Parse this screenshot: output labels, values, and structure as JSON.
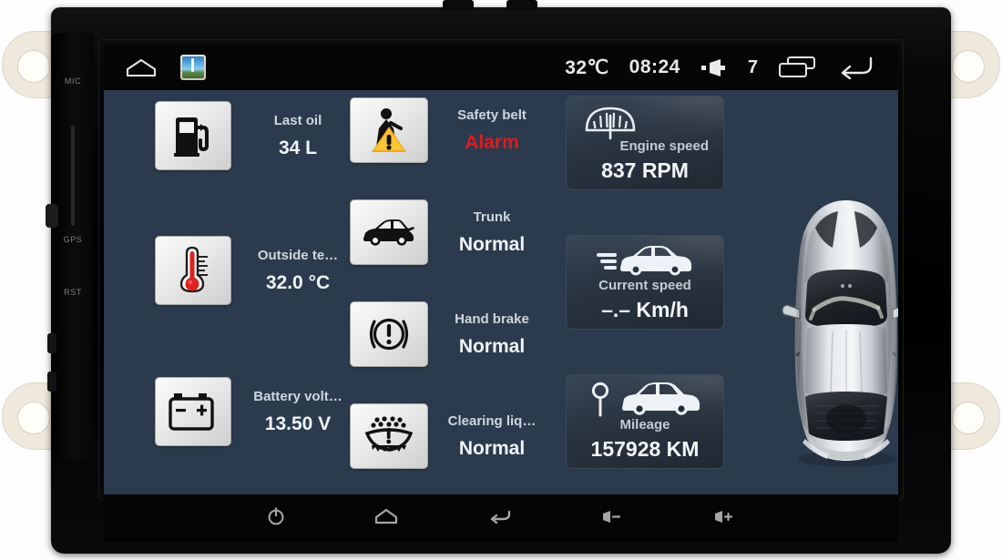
{
  "device": {
    "side_rail_labels": [
      "MIC",
      "GPS",
      "RST"
    ]
  },
  "statusbar": {
    "home_icon": "home-icon",
    "app_icon": "navigation-app-icon",
    "temperature": "32℃",
    "clock": "08:24",
    "volume_icon": "speaker-icon",
    "volume_level": "7",
    "recents_icon": "recent-apps-icon",
    "back_icon": "back-arrow-icon"
  },
  "left_column": [
    {
      "icon": "fuel-pump-icon",
      "label": "Last oil",
      "value": "34 L"
    },
    {
      "icon": "thermometer-icon",
      "label": "Outside te…",
      "value": "32.0 °C"
    },
    {
      "icon": "battery-icon",
      "label": "Battery volt…",
      "value": "13.50 V"
    }
  ],
  "middle_column": [
    {
      "icon": "seatbelt-warning-icon",
      "label": "Safety belt",
      "value": "Alarm",
      "state": "alarm"
    },
    {
      "icon": "car-trunk-icon",
      "label": "Trunk",
      "value": "Normal",
      "state": "normal"
    },
    {
      "icon": "hand-brake-icon",
      "label": "Hand brake",
      "value": "Normal",
      "state": "normal"
    },
    {
      "icon": "washer-fluid-icon",
      "label": "Clearing liq…",
      "value": "Normal",
      "state": "normal"
    }
  ],
  "right_panels": [
    {
      "icon": "tachometer-icon",
      "label": "Engine speed",
      "value": "837 RPM"
    },
    {
      "icon": "moving-car-icon",
      "label": "Current speed",
      "value": "–.– Km/h"
    },
    {
      "icon": "milepost-car-icon",
      "label": "Mileage",
      "value": "157928 KM"
    }
  ],
  "car_graphic": {
    "name": "car-top-view",
    "color": "#b9bdc2"
  },
  "bottom_bar": [
    {
      "icon": "power-icon",
      "name": "power-button"
    },
    {
      "icon": "home-icon",
      "name": "home-button"
    },
    {
      "icon": "back-icon",
      "name": "back-button"
    },
    {
      "icon": "volume-down-icon",
      "name": "volume-down-button"
    },
    {
      "icon": "volume-up-icon",
      "name": "volume-up-button"
    }
  ],
  "colors": {
    "screen_bg": "#2c3a4e",
    "panel_bg": "#2b3643",
    "alarm": "#e01b1b",
    "label": "#cfd6dd",
    "value": "#f0f4f8",
    "bezel": "#000000",
    "bracket": "#efe9dd"
  }
}
